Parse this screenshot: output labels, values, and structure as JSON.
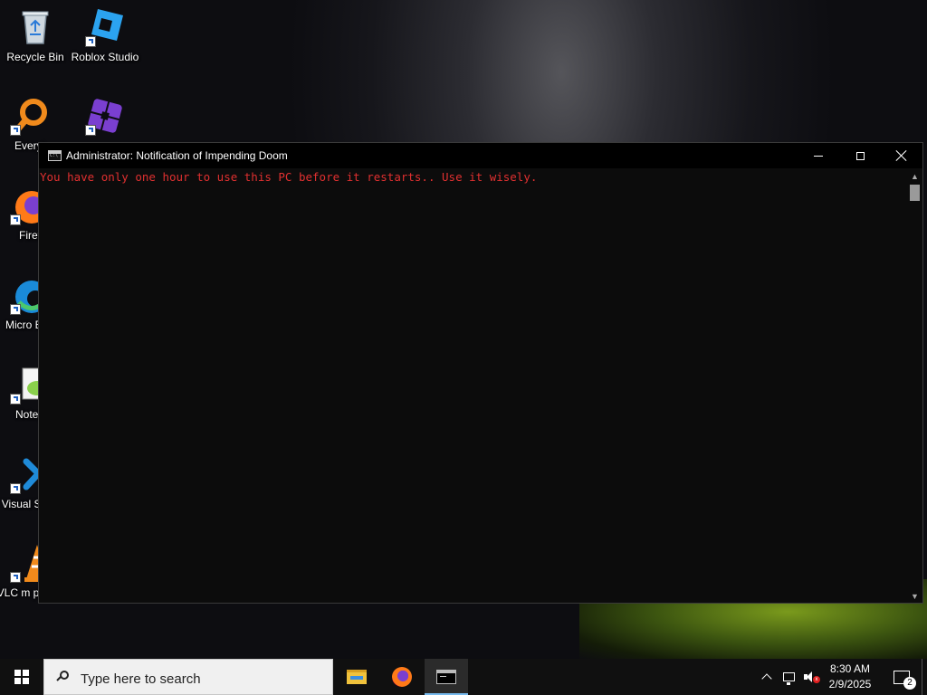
{
  "desktop": {
    "icons": [
      {
        "label": "Recycle Bin"
      },
      {
        "label": "Roblox Studio"
      },
      {
        "label": "Everyt"
      },
      {
        "label": "Firef"
      },
      {
        "label": "Micro Edg"
      },
      {
        "label": "Notep"
      },
      {
        "label": "Visual S Co"
      },
      {
        "label": "VLC m player"
      }
    ]
  },
  "console": {
    "title": "Administrator:  Notification of Impending Doom",
    "output": "You have only one hour to use this PC before it restarts.. Use it wisely.",
    "text_color": "#e03030"
  },
  "taskbar": {
    "search_placeholder": "Type here to search",
    "time": "8:30 AM",
    "date": "2/9/2025",
    "notification_count": "2"
  }
}
